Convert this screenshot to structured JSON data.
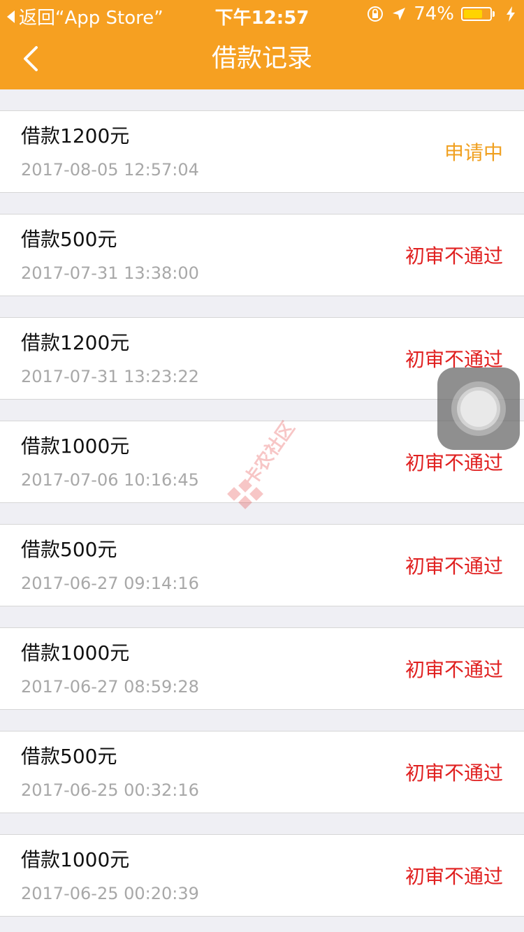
{
  "status_bar": {
    "back_text": "返回“App Store”",
    "time": "下午12:57",
    "battery_percent": "74%",
    "battery_level": 0.74
  },
  "nav": {
    "title": "借款记录"
  },
  "colors": {
    "header": "#F6A021",
    "pending": "#F0A020",
    "rejected": "#E02020"
  },
  "records": [
    {
      "amount": "借款1200元",
      "date": "2017-08-05 12:57:04",
      "status": "申请中",
      "status_type": "pending"
    },
    {
      "amount": "借款500元",
      "date": "2017-07-31 13:38:00",
      "status": "初审不通过",
      "status_type": "rejected"
    },
    {
      "amount": "借款1200元",
      "date": "2017-07-31 13:23:22",
      "status": "初审不通过",
      "status_type": "rejected"
    },
    {
      "amount": "借款1000元",
      "date": "2017-07-06 10:16:45",
      "status": "初审不通过",
      "status_type": "rejected"
    },
    {
      "amount": "借款500元",
      "date": "2017-06-27 09:14:16",
      "status": "初审不通过",
      "status_type": "rejected"
    },
    {
      "amount": "借款1000元",
      "date": "2017-06-27 08:59:28",
      "status": "初审不通过",
      "status_type": "rejected"
    },
    {
      "amount": "借款500元",
      "date": "2017-06-25 00:32:16",
      "status": "初审不通过",
      "status_type": "rejected"
    },
    {
      "amount": "借款1000元",
      "date": "2017-06-25 00:20:39",
      "status": "初审不通过",
      "status_type": "rejected"
    }
  ],
  "watermark_text": "卡农社区"
}
